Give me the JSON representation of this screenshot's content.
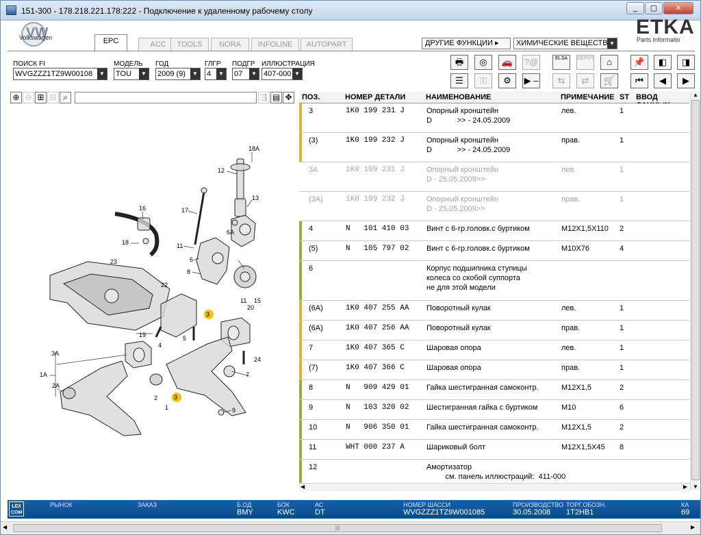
{
  "window": {
    "title": "151-300 - 178.218.221.178:222 - Подключение к удаленному рабочему столу",
    "buttons": {
      "minimize": "_",
      "maximize": "▢",
      "close": "✕"
    }
  },
  "brand": {
    "logo_letters": "VW",
    "name": "Volkswagen",
    "product": "ETKA",
    "product_sub": "Parts Informatio"
  },
  "tabs": [
    {
      "label": "EPC",
      "active": true
    },
    {
      "label": "ACC",
      "active": false
    },
    {
      "label": "TOOLS",
      "active": false
    },
    {
      "label": "NORA",
      "active": false
    },
    {
      "label": "INFOLINE",
      "active": false
    },
    {
      "label": "AUTOPART",
      "active": false
    }
  ],
  "functions": {
    "label": "ДРУГИЕ ФУНКЦИИ ▸",
    "selected": "ХИМИЧЕСКИЕ ВЕЩЕСТВ"
  },
  "filters": [
    {
      "label": "ПОИСК FI",
      "value": "WVGZZZ1TZ9W00108"
    },
    {
      "label": "МОДЕЛЬ",
      "value": "TOU"
    },
    {
      "label": "ГОД",
      "value": "2009 (9)"
    },
    {
      "label": "ГЛГР",
      "value": "4"
    },
    {
      "label": "ПОДГР",
      "value": "07"
    },
    {
      "label": "ИЛЛЮСТРАЦИЯ",
      "value": "407-000"
    }
  ],
  "toolbar": {
    "row1": [
      {
        "icon": "printer-icon",
        "glyph": "🖶",
        "disabled": false
      },
      {
        "icon": "cd-icon",
        "glyph": "◎",
        "disabled": false
      },
      {
        "icon": "car-wrench-icon",
        "glyph": "🚗",
        "disabled": false
      },
      {
        "icon": "help-icon",
        "glyph": "?@",
        "disabled": true
      },
      {
        "icon": "elsa-icon",
        "glyph": "ELSA",
        "disabled": false
      },
      {
        "icon": "depot-icon",
        "glyph": "DEPOT",
        "disabled": true
      },
      {
        "icon": "garage-icon",
        "glyph": "⌂",
        "disabled": false
      },
      {
        "icon": "pin-icon",
        "glyph": "📌",
        "disabled": false
      },
      {
        "icon": "book-back-icon",
        "glyph": "◧",
        "disabled": false
      },
      {
        "icon": "book-forward-icon",
        "glyph": "◨",
        "disabled": false
      }
    ],
    "row2": [
      {
        "icon": "list-icon",
        "glyph": "☰",
        "disabled": false
      },
      {
        "icon": "key-icon",
        "glyph": "⚿",
        "disabled": true
      },
      {
        "icon": "bike-icon",
        "glyph": "⚙",
        "disabled": false
      },
      {
        "icon": "play-dash-icon",
        "glyph": "▶ –",
        "disabled": false
      },
      {
        "icon": "transfer-icon",
        "glyph": "⇆",
        "disabled": true
      },
      {
        "icon": "transfer2-icon",
        "glyph": "⇄",
        "disabled": true
      },
      {
        "icon": "cart-icon",
        "glyph": "🛒",
        "disabled": false
      },
      {
        "icon": "first-icon",
        "glyph": "⏮",
        "disabled": false
      },
      {
        "icon": "prev-icon",
        "glyph": "◀",
        "disabled": false
      },
      {
        "icon": "next-icon",
        "glyph": "▶",
        "disabled": false
      }
    ]
  },
  "table": {
    "headers": {
      "pos": "ПОЗ.",
      "number": "НОМЕР ДЕТАЛИ",
      "name": "НАИМЕНОВАНИЕ",
      "note": "ПРИМЕЧАНИЕ",
      "st": "ST",
      "input": "ВВОД ДАННЫХ"
    },
    "rows": [
      {
        "pos": "3",
        "number": "1K0 199 231 J",
        "name": "Опорный кронштейн\nD            >> - 24.05.2009",
        "note": "лев.",
        "st": "1",
        "bar": "#e8b12a",
        "grey": false
      },
      {
        "pos": "(3)",
        "number": "1K0 199 232 J",
        "name": "Опорный кронштейн\nD            >> - 24.05.2009",
        "note": "прав.",
        "st": "1",
        "bar": "#e8b12a",
        "grey": false
      },
      {
        "pos": "3A",
        "number": "1K0 199 231 J",
        "name": "Опорный кронштейн\nD - 25.05.2009>>",
        "note": "лев.",
        "st": "1",
        "bar": "",
        "grey": true
      },
      {
        "pos": "(3A)",
        "number": "1K0 199 232 J",
        "name": "Опорный кронштейн\nD - 25.05.2009>>",
        "note": "прав.",
        "st": "1",
        "bar": "",
        "grey": true
      },
      {
        "pos": "4",
        "number": "N   101 410 03",
        "name": "Винт с 6-гр.головк.с буртиком",
        "note": "M12X1,5X110",
        "st": "2",
        "bar": "#8db13a",
        "grey": false
      },
      {
        "pos": "(5)",
        "number": "N   105 797 02",
        "name": "Винт с 6-гр.головк.с буртиком",
        "note": "M10X76",
        "st": "4",
        "bar": "#8db13a",
        "grey": false
      },
      {
        "pos": "6",
        "number": "",
        "name": "Корпус подшипника ступицы\nколеса со скобой суппорта\nне для этой модели",
        "note": "",
        "st": "",
        "bar": "#8db13a",
        "grey": false
      },
      {
        "pos": "(6A)",
        "number": "1K0 407 255 AA",
        "name": "Поворотный кулак",
        "note": "лев.",
        "st": "1",
        "bar": "#e8b12a",
        "grey": false
      },
      {
        "pos": "(6A)",
        "number": "1K0 407 256 AA",
        "name": "Поворотный кулак",
        "note": "прав.",
        "st": "1",
        "bar": "#e8b12a",
        "grey": false
      },
      {
        "pos": "7",
        "number": "1K0 407 365 C",
        "name": "Шаровая опора",
        "note": "лев.",
        "st": "1",
        "bar": "#e8b12a",
        "grey": false
      },
      {
        "pos": "(7)",
        "number": "1K0 407 366 C",
        "name": "Шаровая опора",
        "note": "прав.",
        "st": "1",
        "bar": "#e8b12a",
        "grey": false
      },
      {
        "pos": "8",
        "number": "N   909 429 01",
        "name": "Гайка шестигранная самоконтр.",
        "note": "M12X1,5",
        "st": "2",
        "bar": "#8db13a",
        "grey": false
      },
      {
        "pos": "9",
        "number": "N   103 320 02",
        "name": "Шестигранная гайка с буртиком",
        "note": "M10",
        "st": "6",
        "bar": "#8db13a",
        "grey": false
      },
      {
        "pos": "10",
        "number": "N   906 350 01",
        "name": "Гайка шестигранная самоконтр.",
        "note": "M12X1,5",
        "st": "2",
        "bar": "#8db13a",
        "grey": false
      },
      {
        "pos": "11",
        "number": "WHT 000 237 A",
        "name": "Шариковый болт",
        "note": "M12X1,5X45",
        "st": "8",
        "bar": "#8db13a",
        "grey": false
      },
      {
        "pos": "12",
        "number": "",
        "name": "Амортизатор\n         см. панель иллюстраций:  411-000",
        "note": "",
        "st": "",
        "bar": "#8db13a",
        "grey": false
      }
    ]
  },
  "illustration": {
    "callouts": [
      "18A",
      "12",
      "13",
      "16",
      "17",
      "6",
      "6A",
      "18",
      "11",
      "8",
      "23",
      "22",
      "3",
      "11",
      "15",
      "20",
      "19",
      "4",
      "5",
      "3A",
      "1A",
      "2A",
      "24",
      "7",
      "2",
      "3",
      "1",
      "9"
    ]
  },
  "status": {
    "lexcom": "LEX\nCOM",
    "fields": [
      {
        "label": "РЫНОК",
        "value": ""
      },
      {
        "label": "ЗАКАЗ",
        "value": ""
      },
      {
        "label": "Б.ОД",
        "value": "BMY"
      },
      {
        "label": "БОК",
        "value": "KWC"
      },
      {
        "label": "АС",
        "value": "DT"
      },
      {
        "label": "НОМЕР ШАССИ",
        "value": "WVGZZZ1TZ9W001085"
      },
      {
        "label": "ПРОИЗВОДСТВО",
        "value": "30.05.2008"
      },
      {
        "label": "ТОРГ.ОБОЗН.",
        "value": "1T2HB1"
      },
      {
        "label": "КА",
        "value": "69"
      }
    ]
  },
  "scroll_grip": "|||"
}
